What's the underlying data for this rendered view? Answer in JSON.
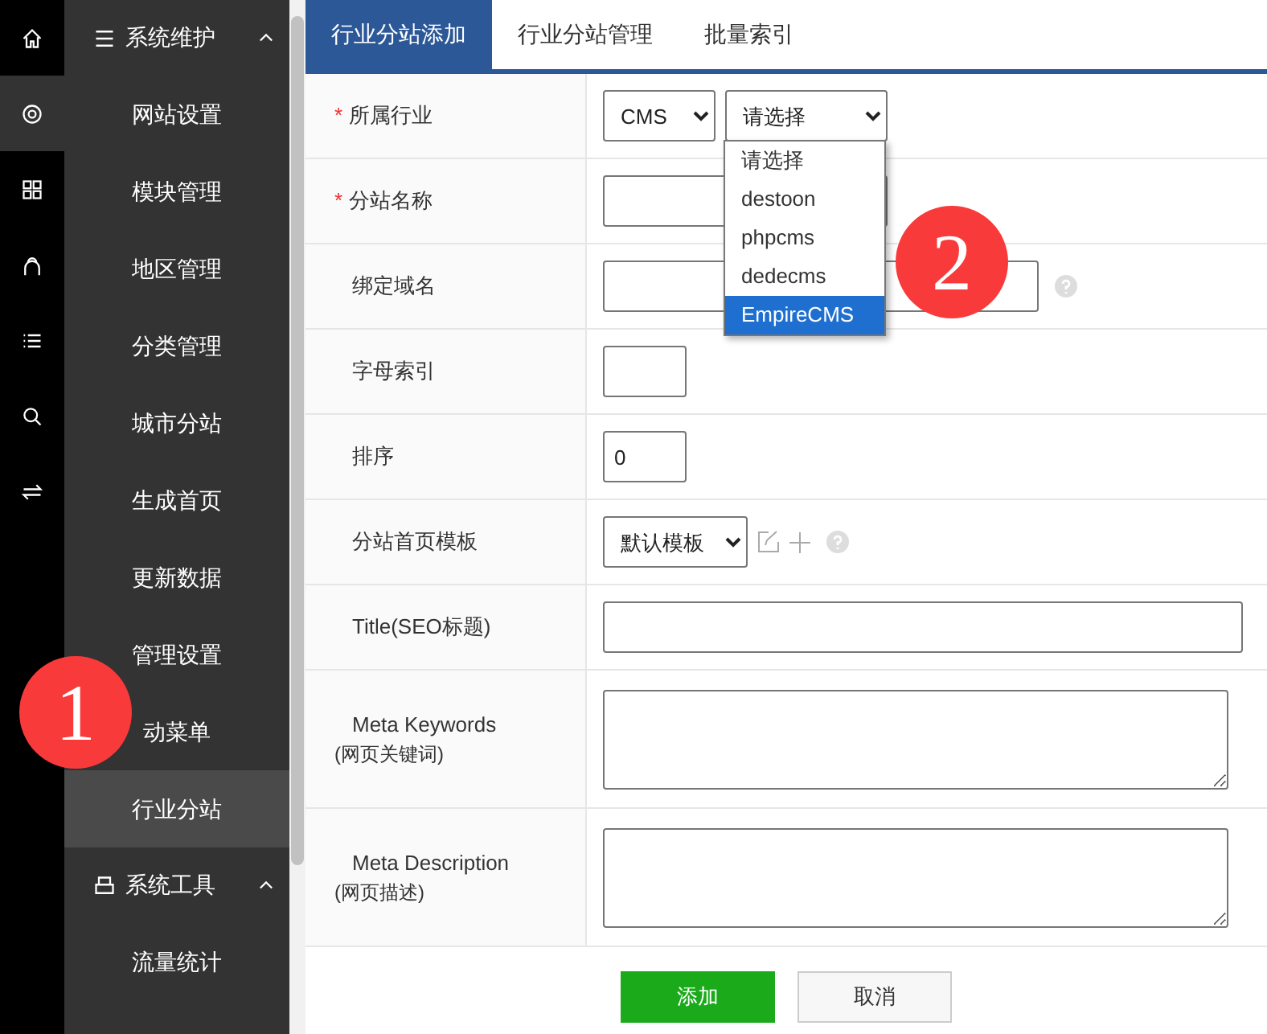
{
  "rail": [
    {
      "kind": "home",
      "selected": false
    },
    {
      "kind": "gear",
      "selected": true
    },
    {
      "kind": "grid",
      "selected": false
    },
    {
      "kind": "user",
      "selected": false
    },
    {
      "kind": "list",
      "selected": false
    },
    {
      "kind": "search",
      "selected": false
    },
    {
      "kind": "swap",
      "selected": false
    }
  ],
  "sidebar": {
    "groups": [
      {
        "title": "系统维护",
        "expanded": true,
        "items": [
          {
            "label": "网站设置",
            "selected": false
          },
          {
            "label": "模块管理",
            "selected": false
          },
          {
            "label": "地区管理",
            "selected": false
          },
          {
            "label": "分类管理",
            "selected": false
          },
          {
            "label": "城市分站",
            "selected": false
          },
          {
            "label": "生成首页",
            "selected": false
          },
          {
            "label": "更新数据",
            "selected": false
          },
          {
            "label": "管理设置",
            "selected": false
          },
          {
            "label": "动菜单",
            "selected": false
          },
          {
            "label": "行业分站",
            "selected": true
          }
        ]
      },
      {
        "title": "系统工具",
        "expanded": true,
        "items": [
          {
            "label": "流量统计",
            "selected": false
          }
        ]
      }
    ]
  },
  "tabs": [
    {
      "label": "行业分站添加",
      "selected": true
    },
    {
      "label": "行业分站管理",
      "selected": false
    },
    {
      "label": "批量索引",
      "selected": false
    }
  ],
  "form": {
    "rows": [
      {
        "label": "所属行业",
        "required_mark": "*",
        "kind": "selects",
        "selects": [
          "CMS",
          "请选择"
        ]
      },
      {
        "label": "分站名称",
        "required_mark": "*",
        "kind": "text"
      },
      {
        "label": "绑定域名",
        "kind": "text",
        "help": true
      },
      {
        "label": "字母索引",
        "kind": "text"
      },
      {
        "label": "排序",
        "kind": "text",
        "value": "0"
      },
      {
        "label": "分站首页模板",
        "kind": "template",
        "selects": [
          "默认模板"
        ]
      },
      {
        "label": "Title(SEO标题)",
        "kind": "text"
      },
      {
        "label": "Meta Keywords",
        "sublabel": "(网页关键词)",
        "kind": "textarea"
      },
      {
        "label": "Meta Description",
        "sublabel": "(网页描述)",
        "kind": "textarea"
      }
    ]
  },
  "dropdown": {
    "options": [
      {
        "label": "请选择",
        "selected": false
      },
      {
        "label": "destoon",
        "selected": false
      },
      {
        "label": "phpcms",
        "selected": false
      },
      {
        "label": "dedecms",
        "selected": false
      },
      {
        "label": "EmpireCMS",
        "selected": true
      }
    ]
  },
  "buttons": [
    {
      "label": "添加",
      "kind": "primary"
    },
    {
      "label": "取消",
      "kind": "secondary"
    }
  ],
  "callouts": [
    {
      "text": "1"
    },
    {
      "text": "2"
    }
  ]
}
